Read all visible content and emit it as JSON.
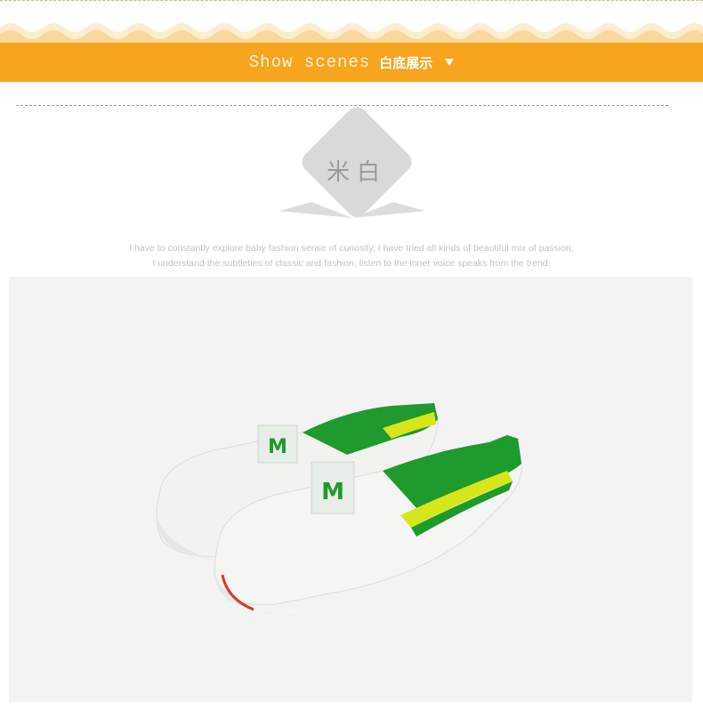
{
  "header": {
    "title_en": "Show scenes",
    "title_cn": "白底展示",
    "arrow_icon": "triangle-down-icon"
  },
  "color_badge": {
    "label": "米白"
  },
  "tagline": {
    "line1": "I have to constantly explore baby fashion sense of curiosity, I have tried all kinds of beautiful mix of passion,",
    "line2": "I understand the subtleties of classic and fashion, listen to the inner voice speaks from the trend."
  },
  "product": {
    "logo_letter": "M",
    "colors": {
      "accent_orange": "#f7a41f",
      "shoe_trim_green": "#1f9a2c",
      "shoe_stripe_yellow": "#d6e61a",
      "shoe_canvas": "#f4f4f2"
    }
  }
}
